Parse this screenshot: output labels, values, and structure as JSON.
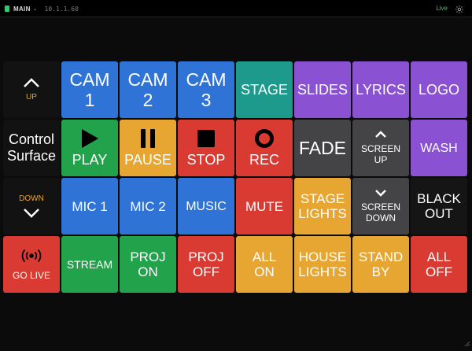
{
  "topbar": {
    "workspace": "MAIN",
    "ip": "10.1.1.60",
    "status": "Live"
  },
  "colors": {
    "blue": "#2f73d6",
    "teal": "#1d9a8c",
    "purple": "#8a52d2",
    "green": "#22a24a",
    "yellow": "#e7a631",
    "red": "#d93a31",
    "dark": "#444447",
    "black": "#151515"
  },
  "grid": {
    "row1": {
      "up": "UP",
      "cam1": [
        "CAM",
        "1"
      ],
      "cam2": [
        "CAM",
        "2"
      ],
      "cam3": [
        "CAM",
        "3"
      ],
      "stage": "STAGE",
      "slides": "SLIDES",
      "lyrics": "LYRICS",
      "logo": "LOGO"
    },
    "row2": {
      "title": [
        "Control",
        "Surface"
      ],
      "play": "PLAY",
      "pause": "PAUSE",
      "stop": "STOP",
      "rec": "REC",
      "fade": "FADE",
      "screen_up": [
        "SCREEN",
        "UP"
      ],
      "wash": "WASH"
    },
    "row3": {
      "down": "DOWN",
      "mic1": "MIC 1",
      "mic2": "MIC 2",
      "music": "MUSIC",
      "mute": "MUTE",
      "stage_lights": [
        "STAGE",
        "LIGHTS"
      ],
      "screen_down": [
        "SCREEN",
        "DOWN"
      ],
      "blackout": [
        "BLACK",
        "OUT"
      ]
    },
    "row4": {
      "go_live": "GO LIVE",
      "stream": "STREAM",
      "proj_on": [
        "PROJ",
        "ON"
      ],
      "proj_off": [
        "PROJ",
        "OFF"
      ],
      "all_on": [
        "ALL",
        "ON"
      ],
      "house_lights": [
        "HOUSE",
        "LIGHTS"
      ],
      "standby": [
        "STAND",
        "BY"
      ],
      "all_off": [
        "ALL",
        "OFF"
      ]
    }
  }
}
